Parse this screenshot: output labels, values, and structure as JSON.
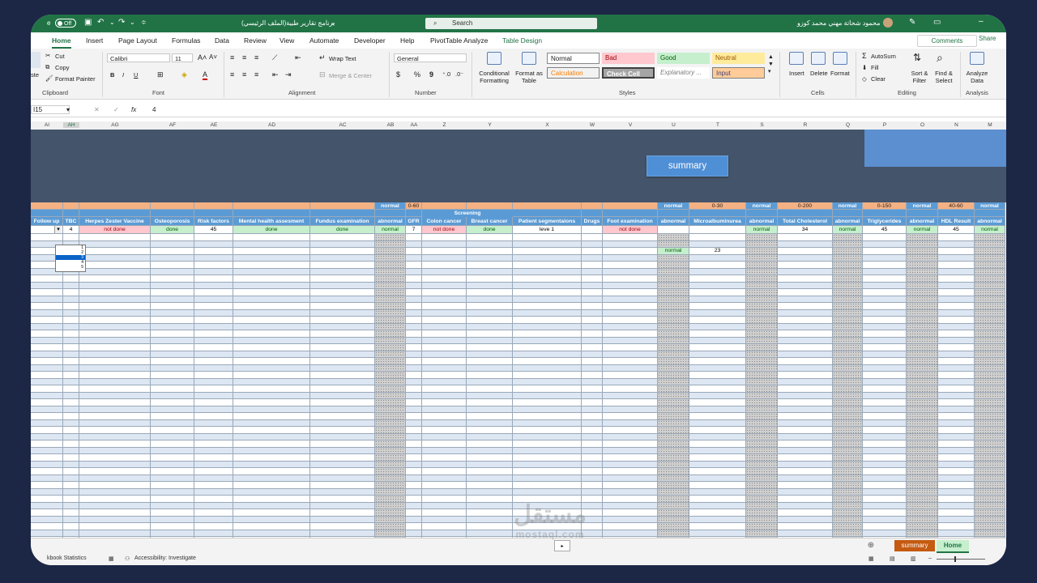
{
  "titlebar": {
    "autosave_suffix": "e",
    "autosave_state": "Off",
    "filename": "برنامج تقارير طبية(الملف الرئيسي)",
    "search_placeholder": "Search",
    "username": "محمود شحاتة مهني محمد كوزو"
  },
  "tabs": [
    "Home",
    "Insert",
    "Page Layout",
    "Formulas",
    "Data",
    "Review",
    "View",
    "Automate",
    "Developer",
    "Help",
    "PivotTable Analyze",
    "Table Design"
  ],
  "tab_actions": {
    "comments": "Comments",
    "share": "Share"
  },
  "ribbon": {
    "clipboard": {
      "cut": "Cut",
      "copy": "Copy",
      "format_painter": "Format Painter",
      "paste": "ste",
      "label": "Clipboard"
    },
    "font": {
      "name": "Calibri",
      "size": "11",
      "label": "Font"
    },
    "alignment": {
      "wrap": "Wrap Text",
      "merge": "Merge & Center",
      "label": "Alignment"
    },
    "number": {
      "format": "General",
      "label": "Number",
      "currency": "$",
      "percent": "%",
      "comma": "9"
    },
    "styles": {
      "conditional": "Conditional Formatting",
      "format_table": "Format as Table",
      "label": "Styles",
      "normal": "Normal",
      "bad": "Bad",
      "good": "Good",
      "neutral": "Neutral",
      "calculation": "Calculation",
      "check_cell": "Check Cell",
      "explanatory": "Explanatory ...",
      "input": "Input"
    },
    "cells": {
      "insert": "Insert",
      "delete": "Delete",
      "format": "Format",
      "label": "Cells"
    },
    "editing": {
      "autosum": "AutoSum",
      "fill": "Fill",
      "clear": "Clear",
      "sort": "Sort & Filter",
      "find": "Find & Select",
      "label": "Editing"
    },
    "analysis": {
      "analyze": "Analyze Data",
      "label": "Analysis"
    }
  },
  "formula_bar": {
    "name_box": "I15",
    "value": "4"
  },
  "columns": [
    "AI",
    "AH",
    "AG",
    "AF",
    "AE",
    "AD",
    "AC",
    "AB",
    "AA",
    "Z",
    "Y",
    "X",
    "W",
    "V",
    "U",
    "T",
    "S",
    "R",
    "Q",
    "P",
    "O",
    "N",
    "M"
  ],
  "banner": {
    "summary_label": "summary"
  },
  "ranges": {
    "ab": "normal",
    "aa": "0-60",
    "z": "Screening",
    "u": "normal",
    "t": "0-30",
    "s": "normal",
    "r": "0-200",
    "q": "normal",
    "p": "0-150",
    "o": "normal",
    "n": "40-60",
    "m": "normal"
  },
  "headers": {
    "ai": "Follow up",
    "ah": "TBC",
    "ag": "Herpes Zester Vaccine",
    "af": "Osteoporosis",
    "ae": "Risk factors",
    "ad": "Mental health assesment",
    "ac": "Fundus examination",
    "ab": "abnormal",
    "aa": "GFR",
    "z": "Colon cancer",
    "y": "Breast cancer",
    "x": "Patient segmentaions",
    "w": "Drugs",
    "v": "Foot examination",
    "u": "abnormal",
    "t": "Microalbuminurea",
    "s": "abnormal",
    "r": "Total Cholesterol",
    "q": "abnormal",
    "p": "Triglycerides",
    "o": "abnormal",
    "n": "HDL Result",
    "m": "abnormal"
  },
  "row1": {
    "ah": "4",
    "ag": "not done",
    "af": "done",
    "ae": "45",
    "ad": "done",
    "ac": "done",
    "ab": "normal",
    "aa": "7",
    "z": "not done",
    "y": "done",
    "x": "leve 1",
    "v": "not done",
    "s": "normal",
    "r": "34",
    "q": "normal",
    "p": "45",
    "o": "normal",
    "n": "45",
    "m": "normal"
  },
  "row3": {
    "u": "normal",
    "t": "23"
  },
  "dropdown_options": [
    "1",
    "2",
    "3",
    "4",
    "5"
  ],
  "sheet_tabs": [
    "summary",
    "Home"
  ],
  "status": {
    "stats": "kbook Statistics",
    "accessibility": "Accessibility: Investigate"
  },
  "watermark": {
    "arabic": "مستقل",
    "latin": "mostaql.com"
  },
  "colors": {
    "excel_green": "#217346",
    "banner": "#44546a",
    "header_blue": "#5b9bd5",
    "orange": "#f4b183",
    "bad_bg": "#ffc7ce",
    "good_bg": "#c6efce"
  }
}
